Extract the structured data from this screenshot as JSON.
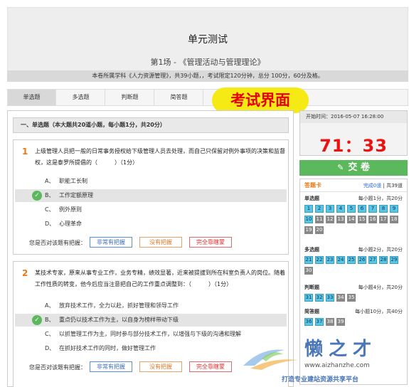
{
  "header": {
    "title": "单元测试",
    "subtitle": "第1场 - 《管理活动与管理理论》",
    "notice": "本卷所属学科《人力资源管理》，共39小题，，考试限定120分钟，总分 100分，60分及格。"
  },
  "tabs": [
    "单选题",
    "多选题",
    "判断题",
    "简答题"
  ],
  "overlay_label": "考试界面",
  "section_title": "一、单选题（本大题共20道小题，每小题1分，共20分）",
  "questions": [
    {
      "number": "1",
      "text": "上级管理人员把一般的日常事务授权给下级管理人员去处理，而自己只保留对例外事项的决策和监督权，这是泰罗所提倡的（　　　）（1分）",
      "options": [
        {
          "letter": "A、",
          "text": "职能工长制",
          "selected": false
        },
        {
          "letter": "B、",
          "text": "工作定额原理",
          "selected": true
        },
        {
          "letter": "C、",
          "text": "例外原则",
          "selected": false
        },
        {
          "letter": "D、",
          "text": "心理革命",
          "selected": false
        }
      ]
    },
    {
      "number": "2",
      "text": "某技术专家，原来从事专业工作，业务专精，绩效显著，近来被提拔到所在科室负责人的岗位。随着工作性质的转变，他今后应当注意把自己的工作重点调整到：（　　　）（1分）",
      "options": [
        {
          "letter": "A、",
          "text": "放弃技术工作，全力以赴，抓好管理和领导工作",
          "selected": false
        },
        {
          "letter": "B、",
          "text": "重点仍以技术工作为主，以自身为榜样带动下级",
          "selected": true
        },
        {
          "letter": "C、",
          "text": "以抓管理工作为主，同时参与部分技术工作，以增强与下级的沟通和理解",
          "selected": false
        },
        {
          "letter": "D、",
          "text": "在抓好技术工作的同时，做好管理工作",
          "selected": false
        }
      ]
    }
  ],
  "confidence": {
    "label": "您是否对该题有把握：",
    "options": [
      "非常有把握",
      "没有把握",
      "完全靠瞎蒙"
    ]
  },
  "sidebar": {
    "start_time": "开始时间：2016-05-07 16:28:00",
    "countdown": "71：33",
    "submit_label": "交  卷",
    "card_title": "答题卡",
    "progress_done": "完成0道",
    "progress_total": " | 共39道",
    "sections": [
      {
        "name": "单选题",
        "desc": "每小题1分，共20分",
        "numbers": [
          1,
          2,
          3,
          4,
          5,
          6,
          7,
          8,
          9,
          10,
          11,
          12,
          13,
          14,
          15,
          16,
          17,
          18,
          19,
          20
        ],
        "done": [
          1,
          2,
          3,
          4,
          5,
          6,
          7,
          8,
          9,
          10
        ]
      },
      {
        "name": "多选题",
        "desc": "每小题2分，共20分",
        "numbers": [
          21,
          22,
          23,
          24,
          25,
          26,
          27,
          28,
          29,
          30
        ],
        "done": [
          21,
          22,
          23,
          24,
          25,
          26,
          27,
          28,
          29
        ]
      },
      {
        "name": "判断题",
        "desc": "每小题4分，共20分",
        "numbers": [
          31,
          32,
          33,
          34,
          35
        ],
        "done": [
          31,
          32,
          33
        ]
      },
      {
        "name": "简答题",
        "desc": "每小题10分，共40分",
        "numbers": [
          36,
          37,
          38,
          39
        ],
        "done": [
          36,
          37
        ]
      }
    ]
  },
  "watermark": {
    "name": "懒之才",
    "url": "www.aizhanzhe.com",
    "slogan": "打造专业建站资源共享平台"
  },
  "colors": {
    "countdown": "#ee1111",
    "submit": "#5cb85c",
    "done_cell": "#58c6e4",
    "accent_orange": "#e87a16"
  }
}
